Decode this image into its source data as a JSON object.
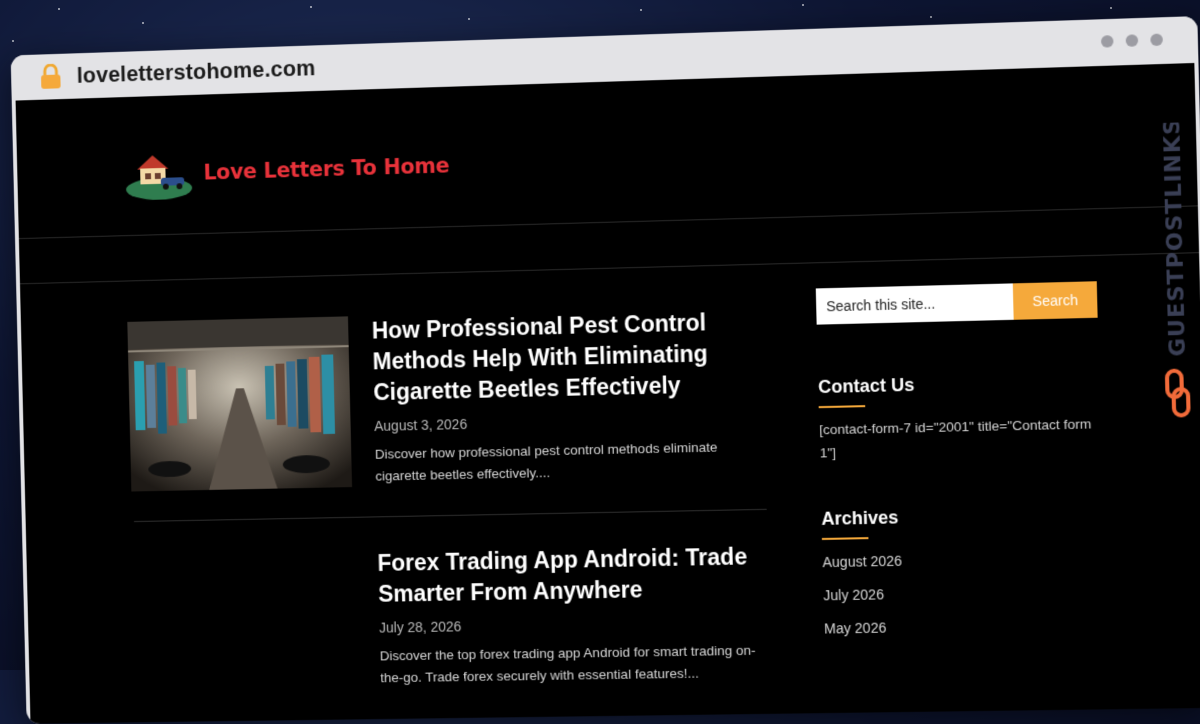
{
  "browser": {
    "url": "loveletterstohome.com"
  },
  "site": {
    "logo_text": "Love Letters To Home"
  },
  "posts": [
    {
      "title": "How Professional Pest Control Methods Help With Eliminating Cigarette Beetles Effectively",
      "date": "August 3, 2026",
      "excerpt": "Discover how professional pest control methods eliminate cigarette beetles effectively...."
    },
    {
      "title": "Forex Trading App Android: Trade Smarter From Anywhere",
      "date": "July 28, 2026",
      "excerpt": "Discover the top forex trading app Android for smart trading on-the-go. Trade forex securely with essential features!..."
    }
  ],
  "sidebar": {
    "search": {
      "placeholder": "Search this site...",
      "button_label": "Search"
    },
    "contact": {
      "title": "Contact Us",
      "text": "[contact-form-7 id=\"2001\" title=\"Contact form 1\"]"
    },
    "archives": {
      "title": "Archives",
      "items": [
        "August 2026",
        "July 2026",
        "May 2026"
      ]
    }
  },
  "watermark": {
    "text": "GUESTPOSTLINKS"
  },
  "colors": {
    "accent": "#f5a93b",
    "logo_red": "#e8323a",
    "page_bg": "#000000",
    "frame": "#e3e3e6"
  }
}
